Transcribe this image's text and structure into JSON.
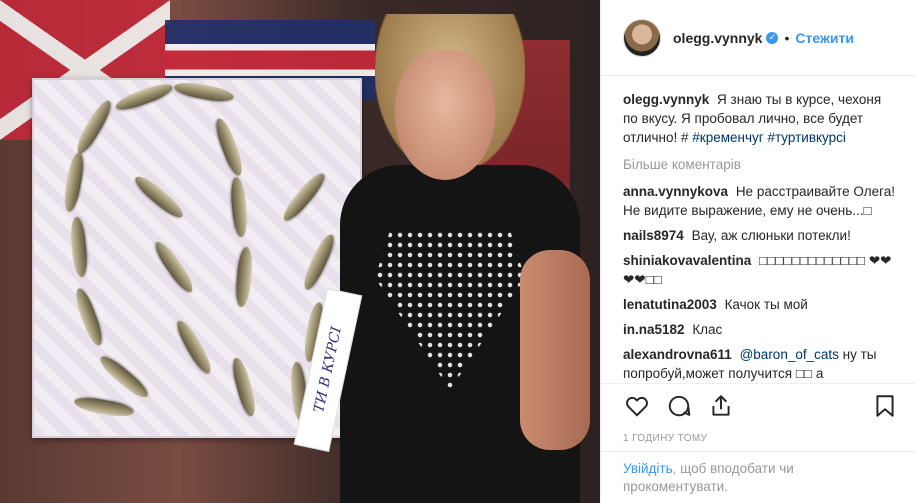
{
  "header": {
    "username": "olegg.vynnyk",
    "separator": "•",
    "follow_label": "Стежити"
  },
  "caption": {
    "username": "olegg.vynnyk",
    "text": "Я знаю ты в курсе, чехоня по вкусу. Я пробовал лично, все будет отлично! #",
    "hashtags": [
      "#кременчуг",
      "#туртивкурсі"
    ]
  },
  "more_comments_label": "Більше коментарів",
  "comments": [
    {
      "user": "anna.vynnykova",
      "text": "Не расстраивайте Олега! Не видите выражение, ему не очень...□"
    },
    {
      "user": "nails8974",
      "text": "Вау, аж слюньки потекли!"
    },
    {
      "user": "shiniakovavalentina",
      "text": "□□□□□□□□□□□□□ ❤❤❤❤□□"
    },
    {
      "user": "lenatutina2003",
      "text": "Качок ты мой"
    },
    {
      "user": "in.na5182",
      "text": "Клас"
    },
    {
      "user": "alexandrovna611",
      "mention": "@baron_of_cats",
      "text": "ну ты попробуй,может получится □□ а"
    }
  ],
  "timestamp": "1 ГОДИНУ ТОМУ",
  "login": {
    "link_label": "Увійдіть",
    "text": ", щоб вподобати чи прокоментувати."
  },
  "photo": {
    "sash_text": "ТИ В КУРСІ",
    "board_letter": "Ш"
  },
  "icons": [
    "heart-icon",
    "comment-icon",
    "share-icon",
    "bookmark-icon",
    "verified-icon"
  ],
  "colors": {
    "link": "#3897f0",
    "hashtag": "#003569",
    "muted": "#999999",
    "text": "#262626"
  }
}
